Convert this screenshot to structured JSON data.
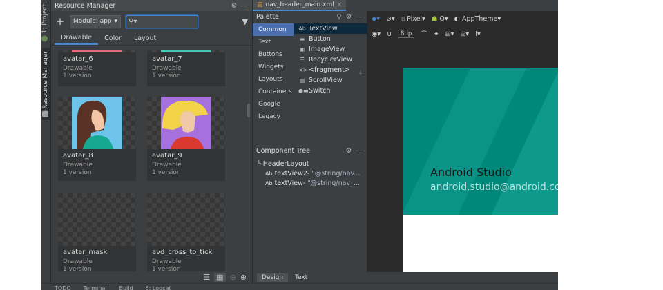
{
  "vertical_tabs": [
    {
      "label": "1: Project",
      "icon": "project-icon"
    },
    {
      "label": "Resource Manager",
      "icon": "resource-manager-icon"
    }
  ],
  "resource_manager": {
    "title": "Resource Manager",
    "module_select": "Module: app",
    "search_value": "",
    "tabs": [
      "Drawable",
      "Color",
      "Layout"
    ],
    "selected_tab": "Drawable",
    "tiles": [
      {
        "name": "avatar_6",
        "type": "Drawable",
        "versions": "1 version"
      },
      {
        "name": "avatar_7",
        "type": "Drawable",
        "versions": "1 version"
      },
      {
        "name": "avatar_8",
        "type": "Drawable",
        "versions": "1 version"
      },
      {
        "name": "avatar_9",
        "type": "Drawable",
        "versions": "1 version"
      },
      {
        "name": "avatar_mask",
        "type": "Drawable",
        "versions": "1 version"
      },
      {
        "name": "avd_cross_to_tick",
        "type": "Drawable",
        "versions": "1 version"
      }
    ]
  },
  "editor": {
    "file_tab": "nav_header_main.xml",
    "palette": {
      "title": "Palette",
      "categories": [
        "Common",
        "Text",
        "Buttons",
        "Widgets",
        "Layouts",
        "Containers",
        "Google",
        "Legacy"
      ],
      "selected_category": "Common",
      "items": [
        {
          "icon": "Ab",
          "label": "TextView"
        },
        {
          "icon": "▬",
          "label": "Button"
        },
        {
          "icon": "▣",
          "label": "ImageView"
        },
        {
          "icon": "☰",
          "label": "RecyclerView"
        },
        {
          "icon": "<>",
          "label": "<fragment>"
        },
        {
          "icon": "▤",
          "label": "ScrollView"
        },
        {
          "icon": "●▬",
          "label": "Switch"
        }
      ]
    },
    "component_tree": {
      "title": "Component Tree",
      "root": "HeaderLayout",
      "children": [
        {
          "icon": "Ab",
          "name": "textView2-",
          "value": "\"@string/nav..."
        },
        {
          "icon": "Ab",
          "name": "textView-",
          "value": "\"@string/nav_..."
        }
      ]
    },
    "toolbar": {
      "device": "Pixel",
      "api": "Q",
      "theme": "AppTheme",
      "margin": "8dp"
    },
    "preview": {
      "title": "Android Studio",
      "subtitle": "android.studio@android.com",
      "header_color": "#00897b"
    },
    "mode_tabs": [
      "Design",
      "Text"
    ],
    "selected_mode": "Design"
  },
  "status_bar": [
    "TODO",
    "Terminal",
    "Build",
    "6: Logcat"
  ]
}
